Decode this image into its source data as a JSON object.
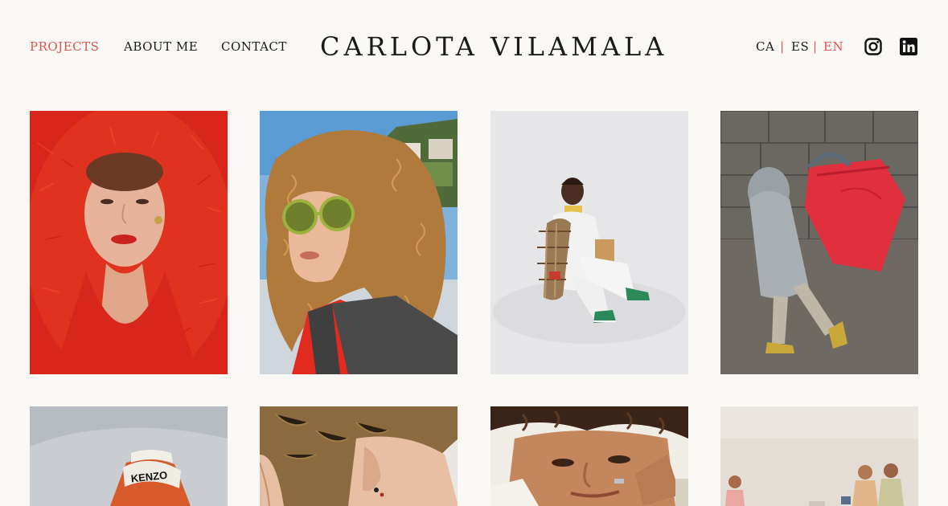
{
  "nav": {
    "projects": "PROJECTS",
    "about": "ABOUT ME",
    "contact": "CONTACT"
  },
  "brand": "CARLOTA VILAMALA",
  "languages": {
    "ca": "CA",
    "es": "ES",
    "en": "EN",
    "separator": "|"
  },
  "social": {
    "instagram": "instagram-icon",
    "linkedin": "linkedin-icon"
  },
  "colors": {
    "background": "#faf8f5",
    "accent": "#d9534f",
    "text": "#1a1a1a"
  },
  "projects": [
    {
      "name": "project-red-fur"
    },
    {
      "name": "project-curly-sunglasses"
    },
    {
      "name": "project-seated-sneakers"
    },
    {
      "name": "project-child-red-bag"
    },
    {
      "name": "project-kenzo-hat"
    },
    {
      "name": "project-short-hair-earrings"
    },
    {
      "name": "project-man-portrait"
    },
    {
      "name": "project-kids-group"
    }
  ],
  "kenzo_hat_text": "KENZO"
}
